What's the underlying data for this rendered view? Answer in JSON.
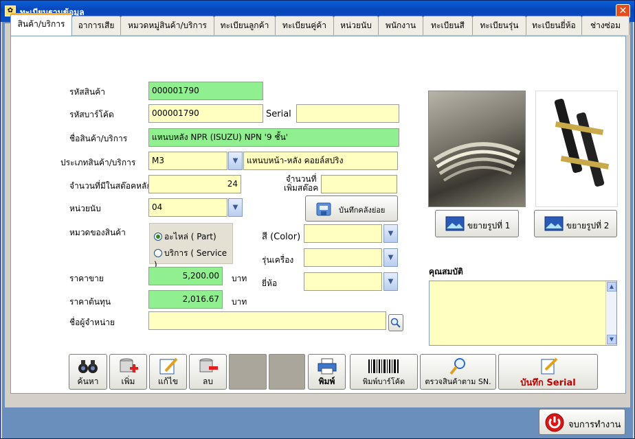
{
  "window": {
    "title": "ทะเบียนฐานข้อมูล"
  },
  "tabs": [
    {
      "label": "สินค้า/บริการ",
      "active": true
    },
    {
      "label": "อาการเสีย"
    },
    {
      "label": "หมวดหมู่สินค้า/บริการ"
    },
    {
      "label": "ทะเบียนลูกค้า"
    },
    {
      "label": "ทะเบียนคู่ค้า"
    },
    {
      "label": "หน่วยนับ"
    },
    {
      "label": "พนักงาน"
    },
    {
      "label": "ทะเบียนสี"
    },
    {
      "label": "ทะเบียนรุ่น"
    },
    {
      "label": "ทะเบียนยี่ห้อ"
    },
    {
      "label": "ช่างซ่อม"
    }
  ],
  "form": {
    "product_code": {
      "label": "รหัสสินค้า",
      "value": "000001790"
    },
    "barcode": {
      "label": "รหัสบาร์โค้ด",
      "value": "000001790"
    },
    "serial": {
      "label": "Serial",
      "value": ""
    },
    "product_name": {
      "label": "ชื่อสินค้า/บริการ",
      "value": "แหนบหลัง  NPR (ISUZU) NPN '9 ชั้น'"
    },
    "product_type": {
      "label": "ประเภทสินค้า/บริการ",
      "value": "M3",
      "desc": "แหนบหน้า-หลัง คอยล์สปริง"
    },
    "stock_qty": {
      "label": "จำนวนที่มีในสต๊อคหลัก",
      "value": "24"
    },
    "add_stock": {
      "label_line1": "จำนวนที่",
      "label_line2": "เพิ่มสต๊อค",
      "value": ""
    },
    "unit": {
      "label": "หน่วยนับ",
      "value": "04"
    },
    "category": {
      "label": "หมวดของสินค้า",
      "options": [
        {
          "label": "อะไหล่ ( Part)",
          "selected": true
        },
        {
          "label": "บริการ ( Service )",
          "selected": false
        }
      ]
    },
    "color": {
      "label": "สี (Color)",
      "value": ""
    },
    "model": {
      "label": "รุ่นเครื่อง",
      "value": ""
    },
    "brand": {
      "label": "ยี่ห้อ",
      "value": ""
    },
    "sale_price": {
      "label": "ราคาขาย",
      "value": "5,200.00",
      "unit": "บาท"
    },
    "cost_price": {
      "label": "ราคาต้นทุน",
      "value": "2,016.67",
      "unit": "บาท"
    },
    "supplier": {
      "label": "ชื่อผู้จำหน่าย",
      "value": ""
    },
    "properties": {
      "label": "คุณสมบัติ",
      "value": ""
    }
  },
  "buttons": {
    "sub_stock": "บันทึกคลังย่อย",
    "enlarge1": "ขยายรูปที่ 1",
    "enlarge2": "ขยายรูปที่ 2",
    "search": "ค้นหา",
    "add": "เพิ่ม",
    "edit": "แก้ไข",
    "delete": "ลบ",
    "print": "พิมพ์",
    "print_barcode": "พิมพ์บาร์โค้ด",
    "check_sn": "ตรวจสินค้าตาม SN.",
    "save_serial": "บันทึก Serial",
    "exit": "จบการทำงาน"
  },
  "colors": {
    "titlebar": "#0846b8",
    "field_yellow": "#ffffc0",
    "field_green": "#90f090",
    "save_serial_text": "#c00000"
  }
}
